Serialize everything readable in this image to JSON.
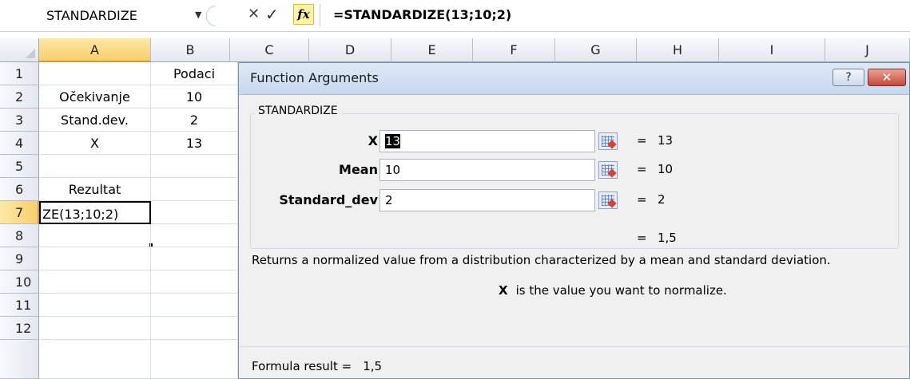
{
  "formula_bar": {
    "name_box": "STANDARDIZE",
    "dropdown_glyph": "▼",
    "cancel_glyph": "✕",
    "enter_glyph": "✓",
    "fx_label": "fx",
    "formula": "=STANDARDIZE(13;10;2)"
  },
  "grid": {
    "columns": [
      "A",
      "B",
      "C",
      "D",
      "E",
      "F",
      "G",
      "H",
      "I",
      "J"
    ],
    "rows": [
      "1",
      "2",
      "3",
      "4",
      "5",
      "6",
      "7",
      "8",
      "9",
      "10",
      "11",
      "12"
    ],
    "cells": {
      "B1": "Podaci",
      "A2": "Očekivanje",
      "B2": "10",
      "A3": "Stand.dev.",
      "B3": "2",
      "A4": "X",
      "B4": "13",
      "A6": "Rezultat",
      "A7": "ZE(13;10;2)"
    },
    "active_cell": "A7"
  },
  "dialog": {
    "title": "Function Arguments",
    "help_glyph": "?",
    "close_glyph": "✕",
    "function_name": "STANDARDIZE",
    "args": [
      {
        "label": "X",
        "value": "13",
        "result": "13"
      },
      {
        "label": "Mean",
        "value": "10",
        "result": "10"
      },
      {
        "label": "Standard_dev",
        "value": "2",
        "result": "2"
      }
    ],
    "eq": "=",
    "result": "1,5",
    "description": "Returns a normalized value from a distribution characterized by a mean and standard deviation.",
    "param_name": "X",
    "param_desc": "is the value you want to normalize.",
    "formula_result_label": "Formula result =",
    "formula_result_value": "1,5"
  },
  "colors": {
    "header_selected": "#f8cf6c",
    "title_bar": "#c7d9ee",
    "close_button": "#c8473a"
  }
}
